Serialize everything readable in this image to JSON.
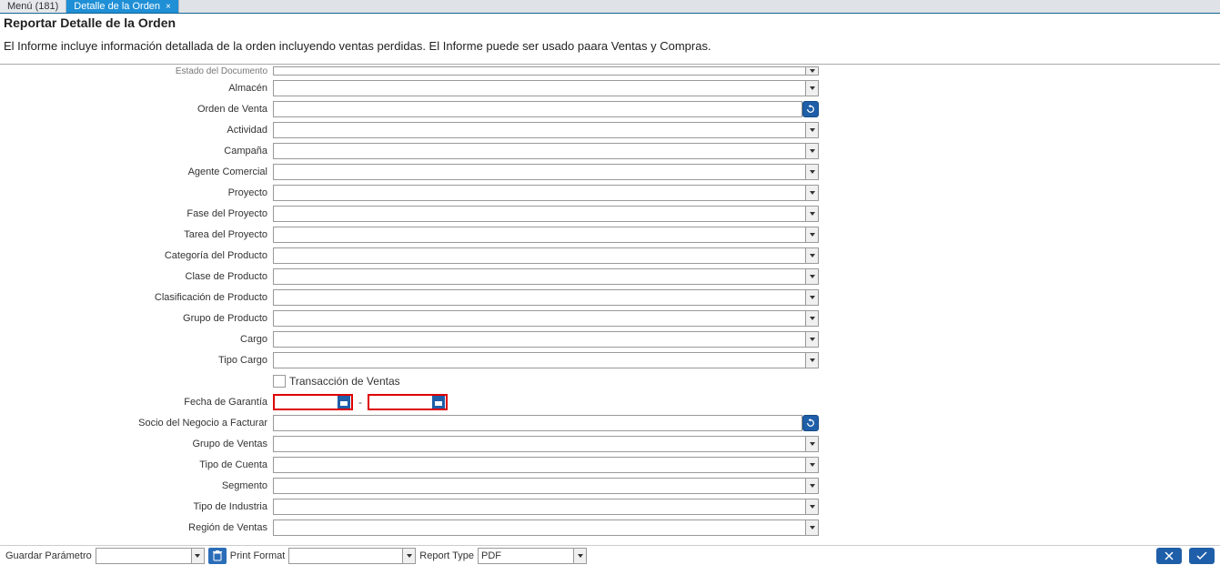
{
  "tabs": {
    "menu": "Menú (181)",
    "detail": "Detalle de la Orden"
  },
  "page": {
    "title": "Reportar Detalle de la Orden",
    "description": "El Informe incluye información detallada de la orden incluyendo ventas perdidas. El Informe puede ser usado paara Ventas y Compras."
  },
  "labels": {
    "estado_documento": "Estado del Documento",
    "almacen": "Almacén",
    "orden_venta": "Orden de Venta",
    "actividad": "Actividad",
    "campana": "Campaña",
    "agente_comercial": "Agente Comercial",
    "proyecto": "Proyecto",
    "fase_proyecto": "Fase del Proyecto",
    "tarea_proyecto": "Tarea del Proyecto",
    "categoria_producto": "Categoría del Producto",
    "clase_producto": "Clase de Producto",
    "clasificacion_producto": "Clasificación de Producto",
    "grupo_producto": "Grupo de Producto",
    "cargo": "Cargo",
    "tipo_cargo": "Tipo Cargo",
    "transaccion_ventas": "Transacción de Ventas",
    "fecha_garantia": "Fecha de Garantía",
    "socio_facturar": "Socio del Negocio a Facturar",
    "grupo_ventas": "Grupo de Ventas",
    "tipo_cuenta": "Tipo de Cuenta",
    "segmento": "Segmento",
    "tipo_industria": "Tipo de Industria",
    "region_ventas": "Región de Ventas"
  },
  "footer": {
    "guardar_parametro": "Guardar Parámetro",
    "print_format": "Print Format",
    "report_type": "Report Type",
    "report_type_value": "PDF"
  },
  "icons": {
    "close": "×",
    "caret": "▾",
    "dash": "-"
  }
}
